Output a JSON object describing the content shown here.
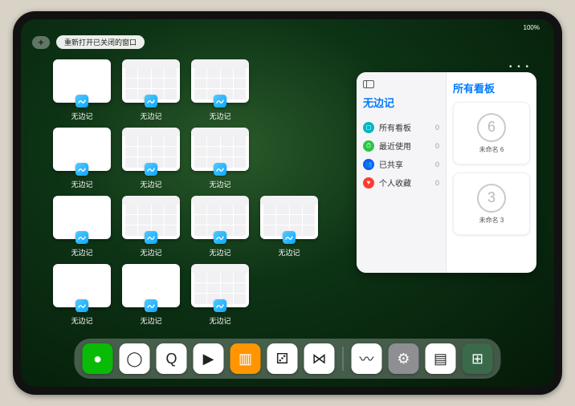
{
  "status": {
    "time": "",
    "right": "100%"
  },
  "topbar": {
    "plus": "+",
    "reopen": "重新打开已关闭的窗口"
  },
  "app_name": "无边记",
  "grid": [
    {
      "type": "blank"
    },
    {
      "type": "cal"
    },
    {
      "type": "cal"
    },
    {
      "_gap": true
    },
    {
      "type": "blank"
    },
    {
      "type": "cal"
    },
    {
      "type": "cal"
    },
    {
      "_gap": true
    },
    {
      "type": "blank"
    },
    {
      "type": "cal"
    },
    {
      "type": "cal"
    },
    {
      "type": "cal"
    },
    {
      "type": "blank"
    },
    {
      "type": "blank"
    },
    {
      "type": "cal"
    },
    {
      "_gap": true
    }
  ],
  "panel": {
    "left_title": "无边记",
    "right_title": "所有看板",
    "items": [
      {
        "icon": "◻",
        "color": "#00b7c3",
        "label": "所有看板",
        "count": "0"
      },
      {
        "icon": "⏱",
        "color": "#28c840",
        "label": "最近使用",
        "count": "0"
      },
      {
        "icon": "👥",
        "color": "#0a5bff",
        "label": "已共享",
        "count": "0"
      },
      {
        "icon": "♥",
        "color": "#ff3b30",
        "label": "个人收藏",
        "count": "0"
      }
    ],
    "boards": [
      {
        "digit": "6",
        "caption": "未命名 6",
        "sub": ""
      },
      {
        "digit": "3",
        "caption": "未命名 3",
        "sub": ""
      }
    ]
  },
  "dock": [
    {
      "name": "wechat",
      "bg": "#09bb07",
      "glyph": "●"
    },
    {
      "name": "quark",
      "bg": "#ffffff",
      "glyph": "◯"
    },
    {
      "name": "qqbrowser",
      "bg": "#ffffff",
      "glyph": "Q"
    },
    {
      "name": "play",
      "bg": "#ffffff",
      "glyph": "▶"
    },
    {
      "name": "books",
      "bg": "#ff9500",
      "glyph": "▥"
    },
    {
      "name": "dice",
      "bg": "#ffffff",
      "glyph": "⚂"
    },
    {
      "name": "connect",
      "bg": "#ffffff",
      "glyph": "⋈"
    },
    {
      "_sep": true
    },
    {
      "name": "freeform",
      "bg": "#ffffff",
      "glyph": "〰"
    },
    {
      "name": "settings",
      "bg": "#8e8e93",
      "glyph": "⚙"
    },
    {
      "name": "notes",
      "bg": "#ffffff",
      "glyph": "▤"
    },
    {
      "name": "app-library",
      "bg": "#3a6a4a",
      "glyph": "⊞"
    }
  ]
}
